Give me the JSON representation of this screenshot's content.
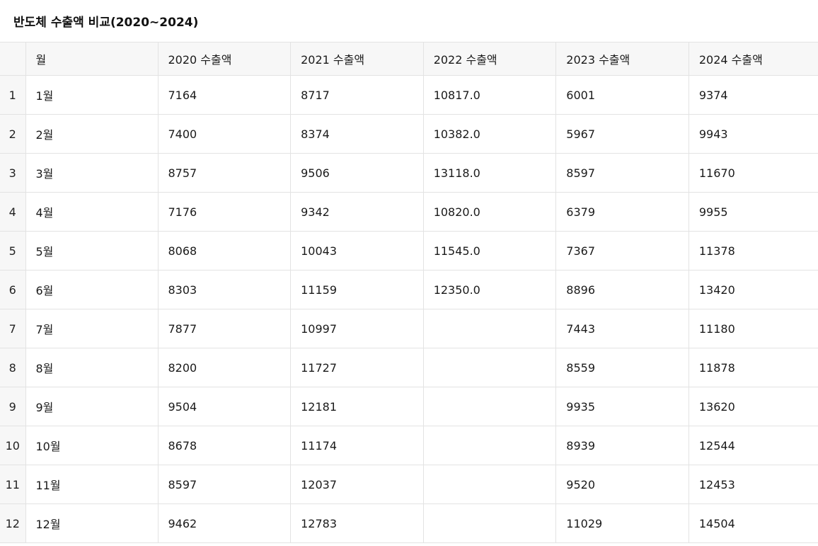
{
  "title": "반도체 수출액 비교(2020~2024)",
  "table": {
    "headers": [
      "",
      "월",
      "2020 수출액",
      "2021 수출액",
      "2022 수출액",
      "2023 수출액",
      "2024 수출액"
    ],
    "rows": [
      [
        "1",
        "1월",
        "7164",
        "8717",
        "10817.0",
        "6001",
        "9374"
      ],
      [
        "2",
        "2월",
        "7400",
        "8374",
        "10382.0",
        "5967",
        "9943"
      ],
      [
        "3",
        "3월",
        "8757",
        "9506",
        "13118.0",
        "8597",
        "11670"
      ],
      [
        "4",
        "4월",
        "7176",
        "9342",
        "10820.0",
        "6379",
        "9955"
      ],
      [
        "5",
        "5월",
        "8068",
        "10043",
        "11545.0",
        "7367",
        "11378"
      ],
      [
        "6",
        "6월",
        "8303",
        "11159",
        "12350.0",
        "8896",
        "13420"
      ],
      [
        "7",
        "7월",
        "7877",
        "10997",
        "",
        "7443",
        "11180"
      ],
      [
        "8",
        "8월",
        "8200",
        "11727",
        "",
        "8559",
        "11878"
      ],
      [
        "9",
        "9월",
        "9504",
        "12181",
        "",
        "9935",
        "13620"
      ],
      [
        "10",
        "10월",
        "8678",
        "11174",
        "",
        "8939",
        "12544"
      ],
      [
        "11",
        "11월",
        "8597",
        "12037",
        "",
        "9520",
        "12453"
      ],
      [
        "12",
        "12월",
        "9462",
        "12783",
        "",
        "11029",
        "14504"
      ]
    ]
  }
}
